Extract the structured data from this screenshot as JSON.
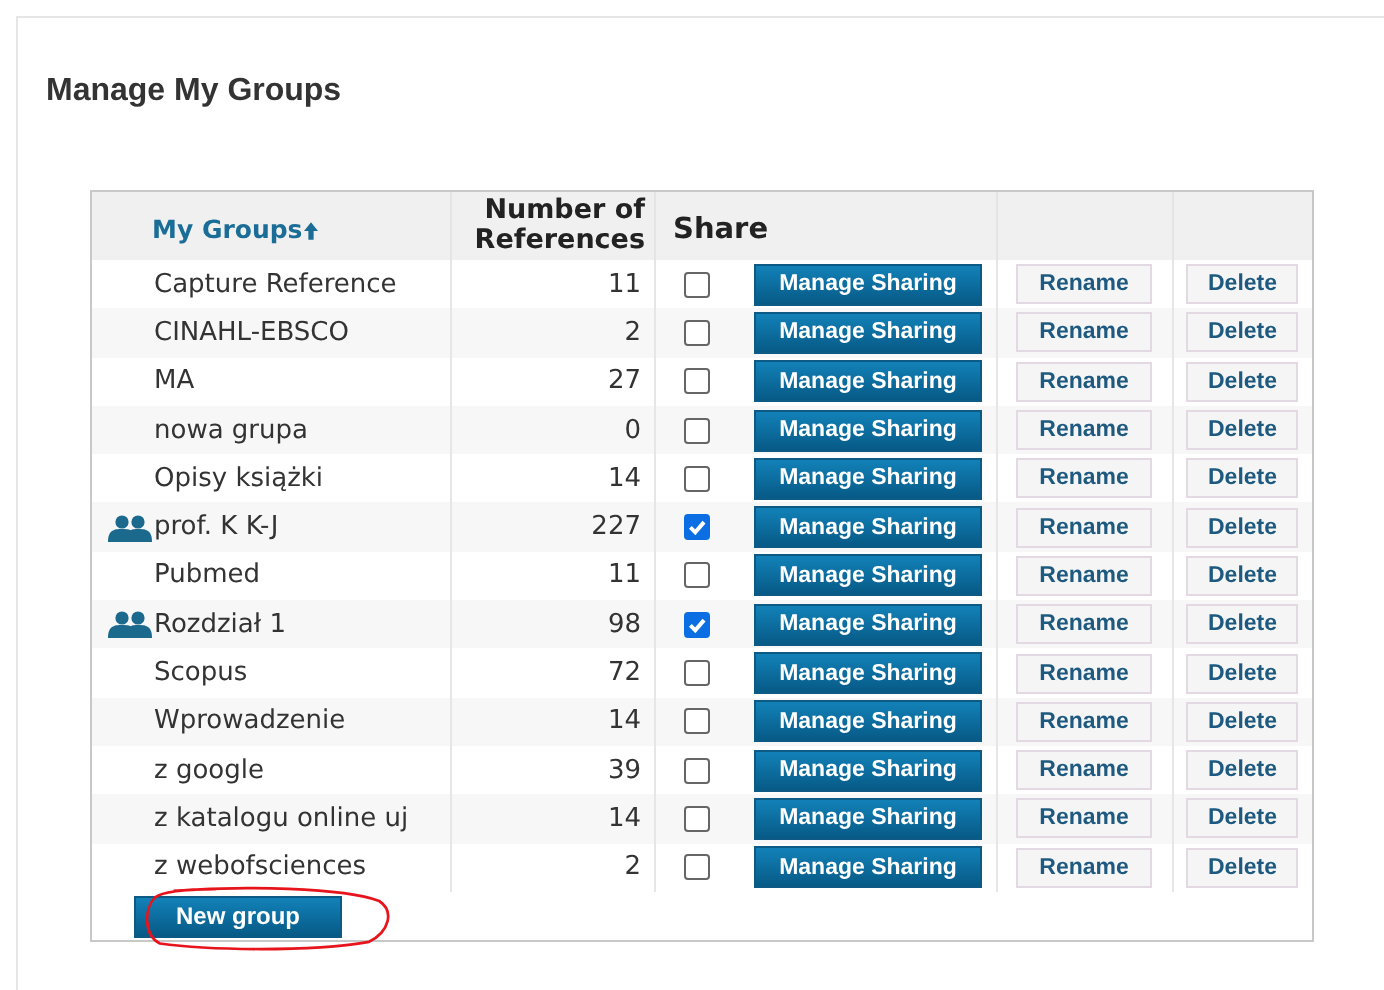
{
  "page": {
    "title": "Manage My Groups"
  },
  "table": {
    "columns": [
      {
        "label": "My Groups",
        "sorted": true
      },
      {
        "label": "Number of References"
      },
      {
        "label": "Share"
      }
    ],
    "rows": [
      {
        "name": "Capture Reference",
        "count": "11",
        "shared": false,
        "actions": [
          "Manage Sharing",
          "Rename",
          "Delete"
        ]
      },
      {
        "name": "CINAHL-EBSCO",
        "count": "2",
        "shared": false,
        "actions": [
          "Manage Sharing",
          "Rename",
          "Delete"
        ]
      },
      {
        "name": "MA",
        "count": "27",
        "shared": false,
        "actions": [
          "Manage Sharing",
          "Rename",
          "Delete"
        ]
      },
      {
        "name": "nowa grupa",
        "count": "0",
        "shared": false,
        "actions": [
          "Manage Sharing",
          "Rename",
          "Delete"
        ]
      },
      {
        "name": "Opisy książki",
        "count": "14",
        "shared": false,
        "actions": [
          "Manage Sharing",
          "Rename",
          "Delete"
        ]
      },
      {
        "name": "prof. K K-J",
        "count": "227",
        "shared": true,
        "actions": [
          "Manage Sharing",
          "Rename",
          "Delete"
        ]
      },
      {
        "name": "Pubmed",
        "count": "11",
        "shared": false,
        "actions": [
          "Manage Sharing",
          "Rename",
          "Delete"
        ]
      },
      {
        "name": "Rozdział 1",
        "count": "98",
        "shared": true,
        "actions": [
          "Manage Sharing",
          "Rename",
          "Delete"
        ]
      },
      {
        "name": "Scopus",
        "count": "72",
        "shared": false,
        "actions": [
          "Manage Sharing",
          "Rename",
          "Delete"
        ]
      },
      {
        "name": "Wprowadzenie",
        "count": "14",
        "shared": false,
        "actions": [
          "Manage Sharing",
          "Rename",
          "Delete"
        ]
      },
      {
        "name": "z google",
        "count": "39",
        "shared": false,
        "actions": [
          "Manage Sharing",
          "Rename",
          "Delete"
        ]
      },
      {
        "name": "z katalogu online uj",
        "count": "14",
        "shared": false,
        "actions": [
          "Manage Sharing",
          "Rename",
          "Delete"
        ]
      },
      {
        "name": "z webofsciences",
        "count": "2",
        "shared": false,
        "actions": [
          "Manage Sharing",
          "Rename",
          "Delete"
        ]
      }
    ]
  },
  "new_group_button": {
    "label": "New group",
    "circled": true
  }
}
